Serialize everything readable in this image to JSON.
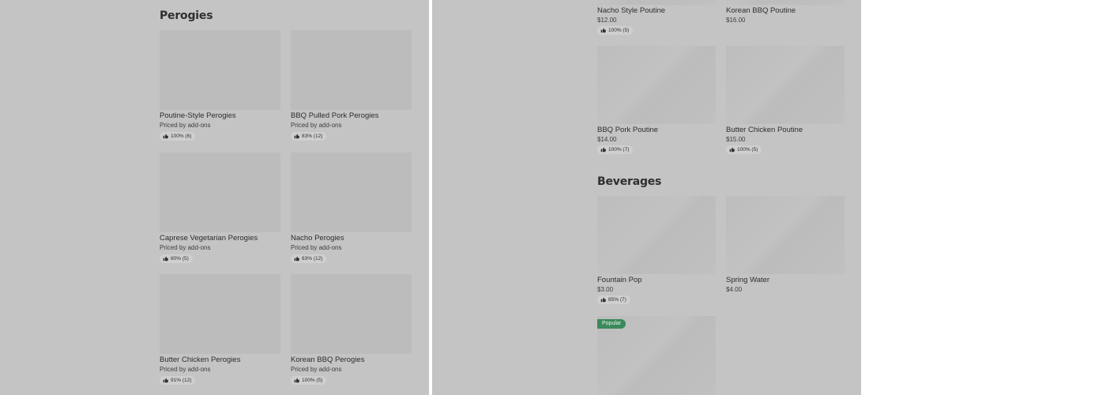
{
  "left_panel": {
    "section_title": "Perogies",
    "items": [
      {
        "name": "Poutine-Style Perogies",
        "price": "Priced by add-ons",
        "rating": "100% (6)"
      },
      {
        "name": "BBQ Pulled Pork Perogies",
        "price": "Priced by add-ons",
        "rating": "83% (12)"
      },
      {
        "name": "Caprese Vegetarian Perogies",
        "price": "Priced by add-ons",
        "rating": "80% (5)"
      },
      {
        "name": "Nacho Perogies",
        "price": "Priced by add-ons",
        "rating": "83% (12)"
      },
      {
        "name": "Butter Chicken Perogies",
        "price": "Priced by add-ons",
        "rating": "91% (12)"
      },
      {
        "name": "Korean BBQ Perogies",
        "price": "Priced by add-ons",
        "rating": "100% (5)"
      }
    ]
  },
  "right_panel": {
    "poutine_items": [
      {
        "name": "Nacho Style Poutine",
        "price": "$12.00",
        "rating": "100% (5)"
      },
      {
        "name": "Korean BBQ Poutine",
        "price": "$16.00",
        "rating": ""
      },
      {
        "name": "BBQ Pork Poutine",
        "price": "$14.00",
        "rating": "100% (7)"
      },
      {
        "name": "Butter Chicken Poutine",
        "price": "$15.00",
        "rating": "100% (5)"
      }
    ],
    "beverages_title": "Beverages",
    "beverage_items": [
      {
        "name": "Fountain Pop",
        "price": "$3.00",
        "rating": "85% (7)"
      },
      {
        "name": "Spring Water",
        "price": "$4.00",
        "rating": ""
      }
    ],
    "popular_badge": "Popular"
  },
  "icons": {
    "rating": "thumbs-up-icon"
  }
}
